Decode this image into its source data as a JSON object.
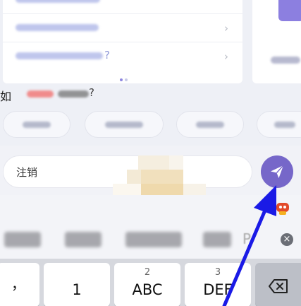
{
  "help_panel": {
    "faq_question_suffix": "?",
    "chevron": "›"
  },
  "question": {
    "lead_char": "如",
    "question_mark": "?"
  },
  "composer": {
    "input_value": "注销",
    "send_icon": "paper-plane-icon"
  },
  "candidate_bar": {
    "partial_glyph": "P"
  },
  "keyboard": {
    "punct_key": "，",
    "keys": [
      {
        "num": "",
        "label": "1"
      },
      {
        "num": "2",
        "label": "ABC"
      },
      {
        "num": "3",
        "label": "DEF"
      }
    ],
    "delete_icon": "backspace-icon"
  },
  "colors": {
    "accent": "#7667c9",
    "annotation_arrow": "#1a1ae6",
    "highlight_red": "#e24a4a"
  }
}
